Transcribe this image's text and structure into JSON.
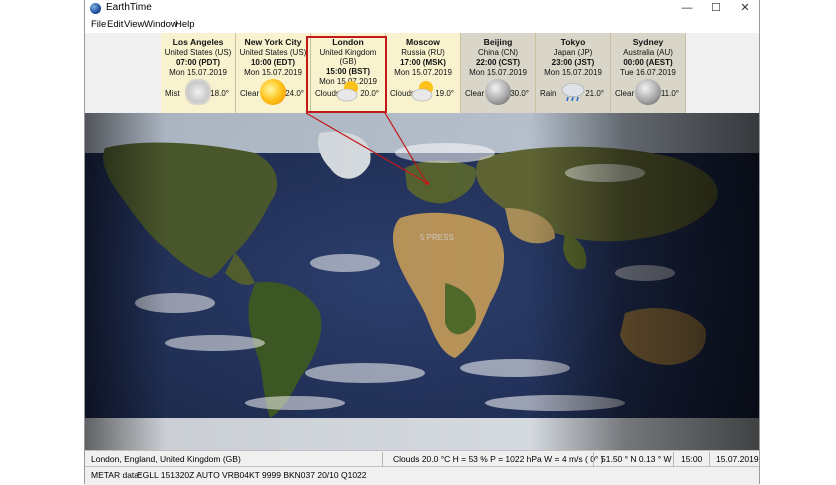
{
  "window": {
    "title": "EarthTime",
    "minimize": "—",
    "maximize": "☐",
    "close": "✕"
  },
  "menu": [
    "File",
    "Edit",
    "View",
    "Window",
    "Help"
  ],
  "cities": [
    {
      "name": "Los Angeles",
      "country": "United States (US)",
      "time": "07:00 (PDT)",
      "date": "Mon 15.07.2019",
      "condition": "Mist",
      "temp": "18.0°",
      "icon": "mist-icon",
      "phase": "day"
    },
    {
      "name": "New York City",
      "country": "United States (US)",
      "time": "10:00 (EDT)",
      "date": "Mon 15.07.2019",
      "condition": "Clear",
      "temp": "24.0°",
      "icon": "sun-icon",
      "phase": "day"
    },
    {
      "name": "London",
      "country": "United Kingdom (GB)",
      "time": "15:00 (BST)",
      "date": "Mon 15.07.2019",
      "condition": "Clouds",
      "temp": "20.0°",
      "icon": "sun-cloud-icon",
      "phase": "day"
    },
    {
      "name": "Moscow",
      "country": "Russia (RU)",
      "time": "17:00 (MSK)",
      "date": "Mon 15.07.2019",
      "condition": "Clouds",
      "temp": "19.0°",
      "icon": "sun-cloud-icon",
      "phase": "day"
    },
    {
      "name": "Beijing",
      "country": "China (CN)",
      "time": "22:00 (CST)",
      "date": "Mon 15.07.2019",
      "condition": "Clear",
      "temp": "30.0°",
      "icon": "moon-icon",
      "phase": "night"
    },
    {
      "name": "Tokyo",
      "country": "Japan (JP)",
      "time": "23:00 (JST)",
      "date": "Mon 15.07.2019",
      "condition": "Rain",
      "temp": "21.0°",
      "icon": "rain-cloud-icon",
      "phase": "night"
    },
    {
      "name": "Sydney",
      "country": "Australia (AU)",
      "time": "00:00 (AEST)",
      "date": "Tue 16.07.2019",
      "condition": "Clear",
      "temp": "11.0°",
      "icon": "moon-icon",
      "phase": "night"
    }
  ],
  "status": {
    "location": "London, England, United Kingdom (GB)",
    "weather": "Clouds   20.0 °C   H = 53 %   P = 1022 hPa   W = 4 m/s  ( 0° )",
    "coords": "51.50 ° N  0.13 ° W",
    "time": "15:00",
    "date": "15.07.2019"
  },
  "metar": {
    "label": "METAR data:",
    "value": "EGLL 151320Z AUTO VRB04KT 9999 BKN037 20/10 Q1022"
  },
  "map": {
    "watermark": "5 PRESS"
  }
}
